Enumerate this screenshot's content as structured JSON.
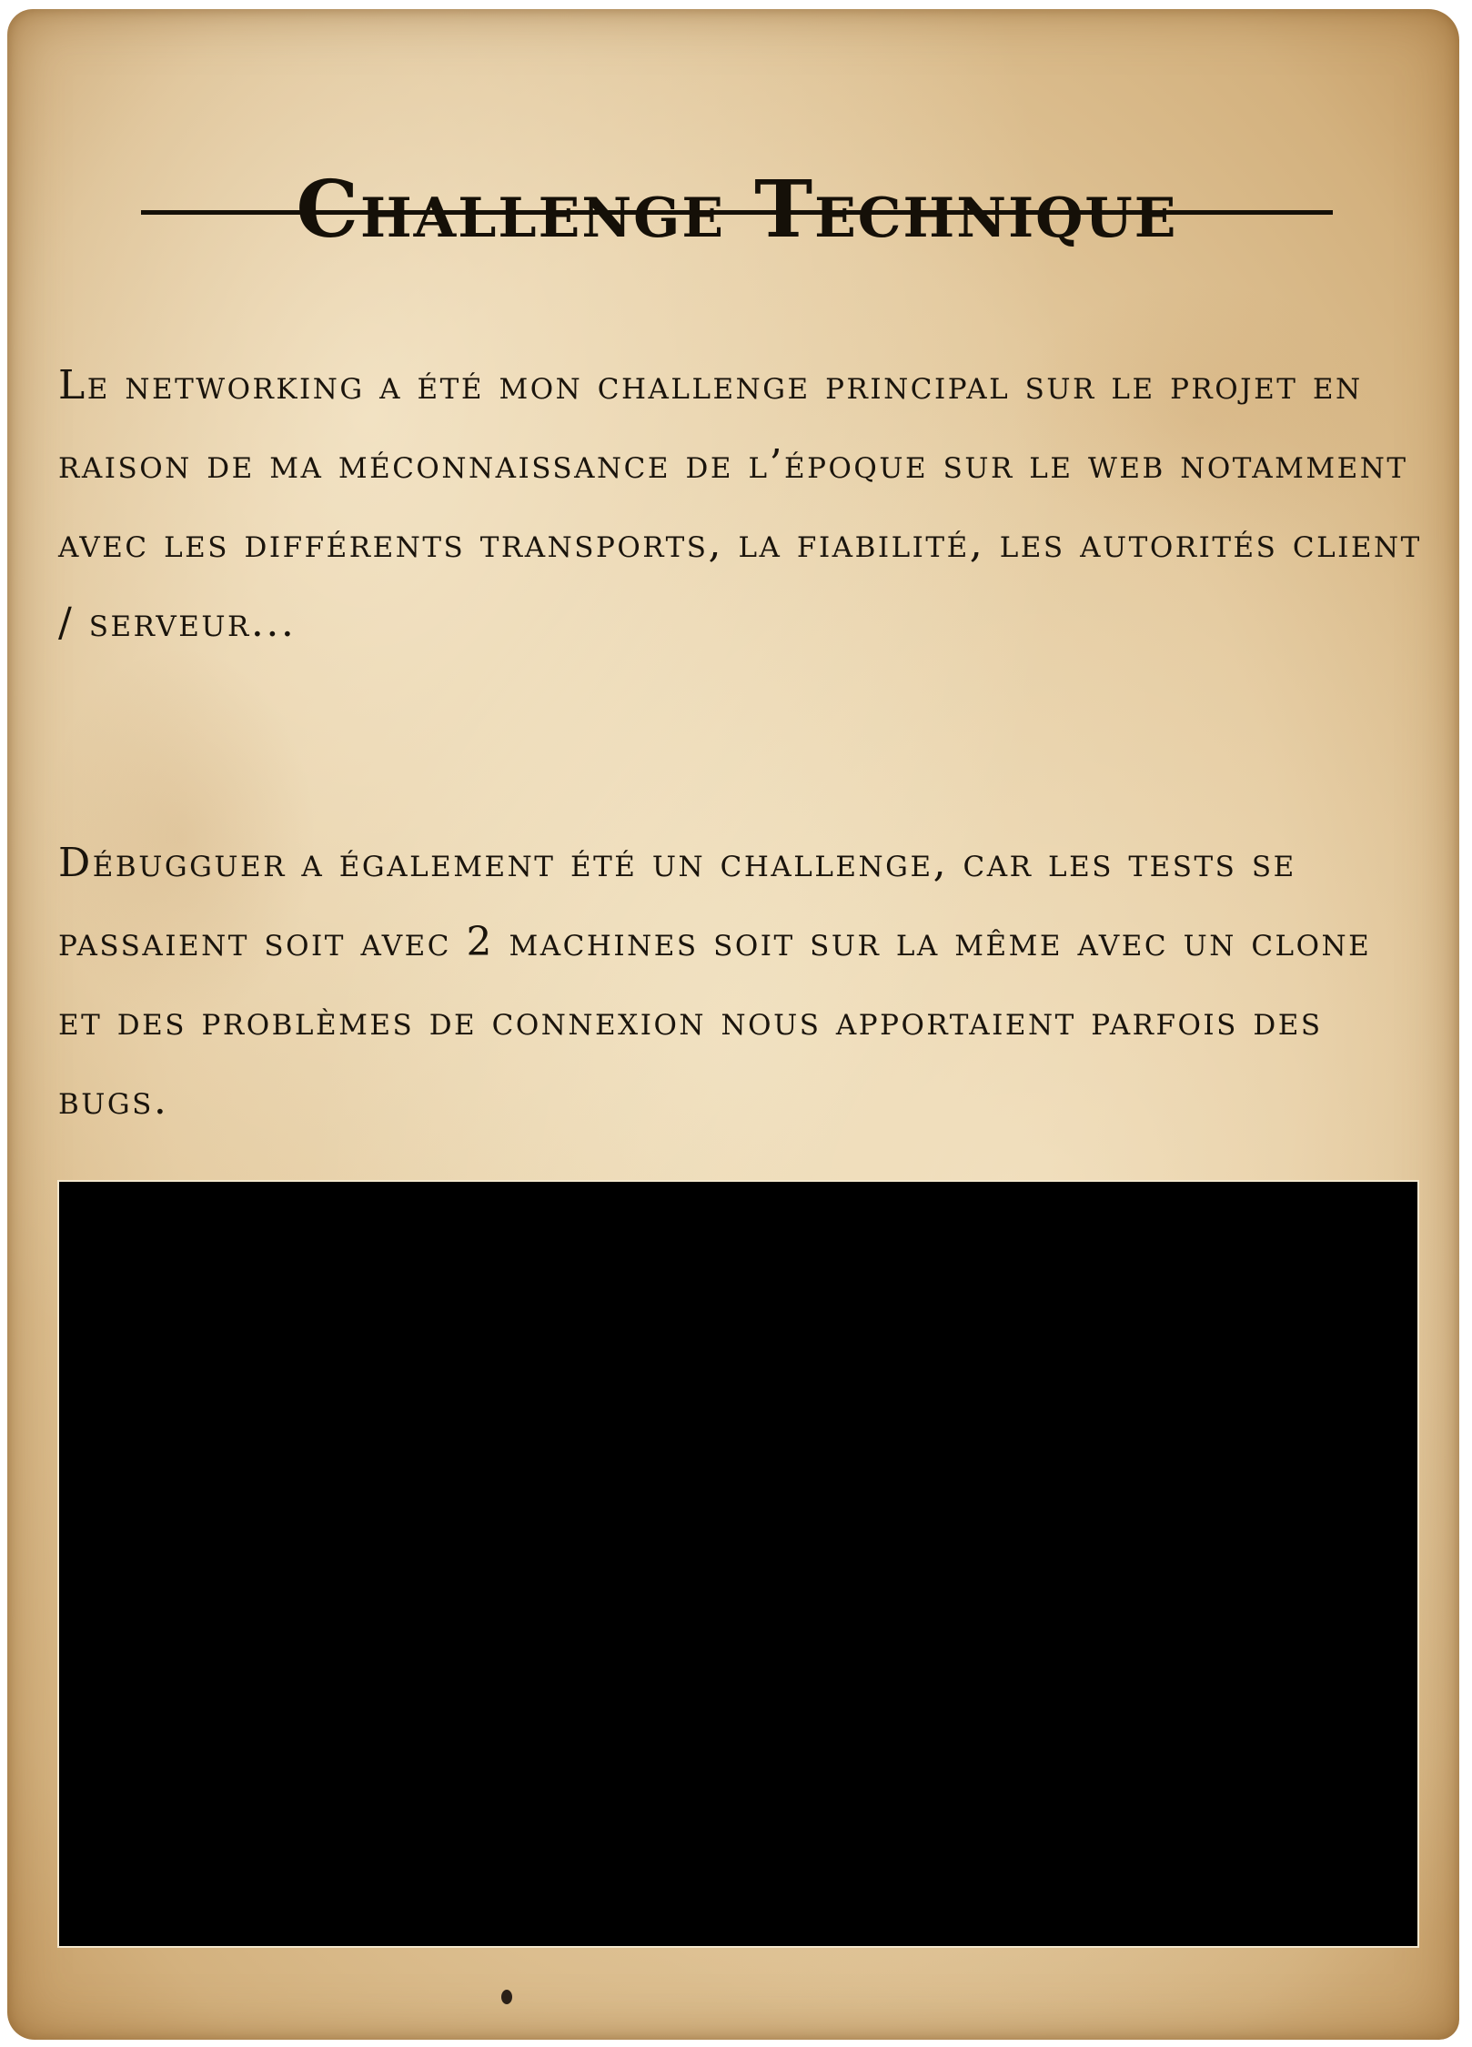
{
  "card": {
    "title": "Challenge Technique",
    "paragraphs": [
      "Le networking a été mon challenge principal sur le projet en raison de ma méconnaissance de l’époque sur le web notamment avec les différents transports, la fiabilité, les autorités client / serveur...",
      "Débugguer a également été un challenge, car les tests se passaient soit avec 2 machines soit sur la même avec un clone et des problèmes de connexion nous apportaient parfois des bugs."
    ]
  },
  "colors": {
    "ink": "#151008",
    "parchment": "#e2c79b",
    "media_background": "#000000"
  }
}
